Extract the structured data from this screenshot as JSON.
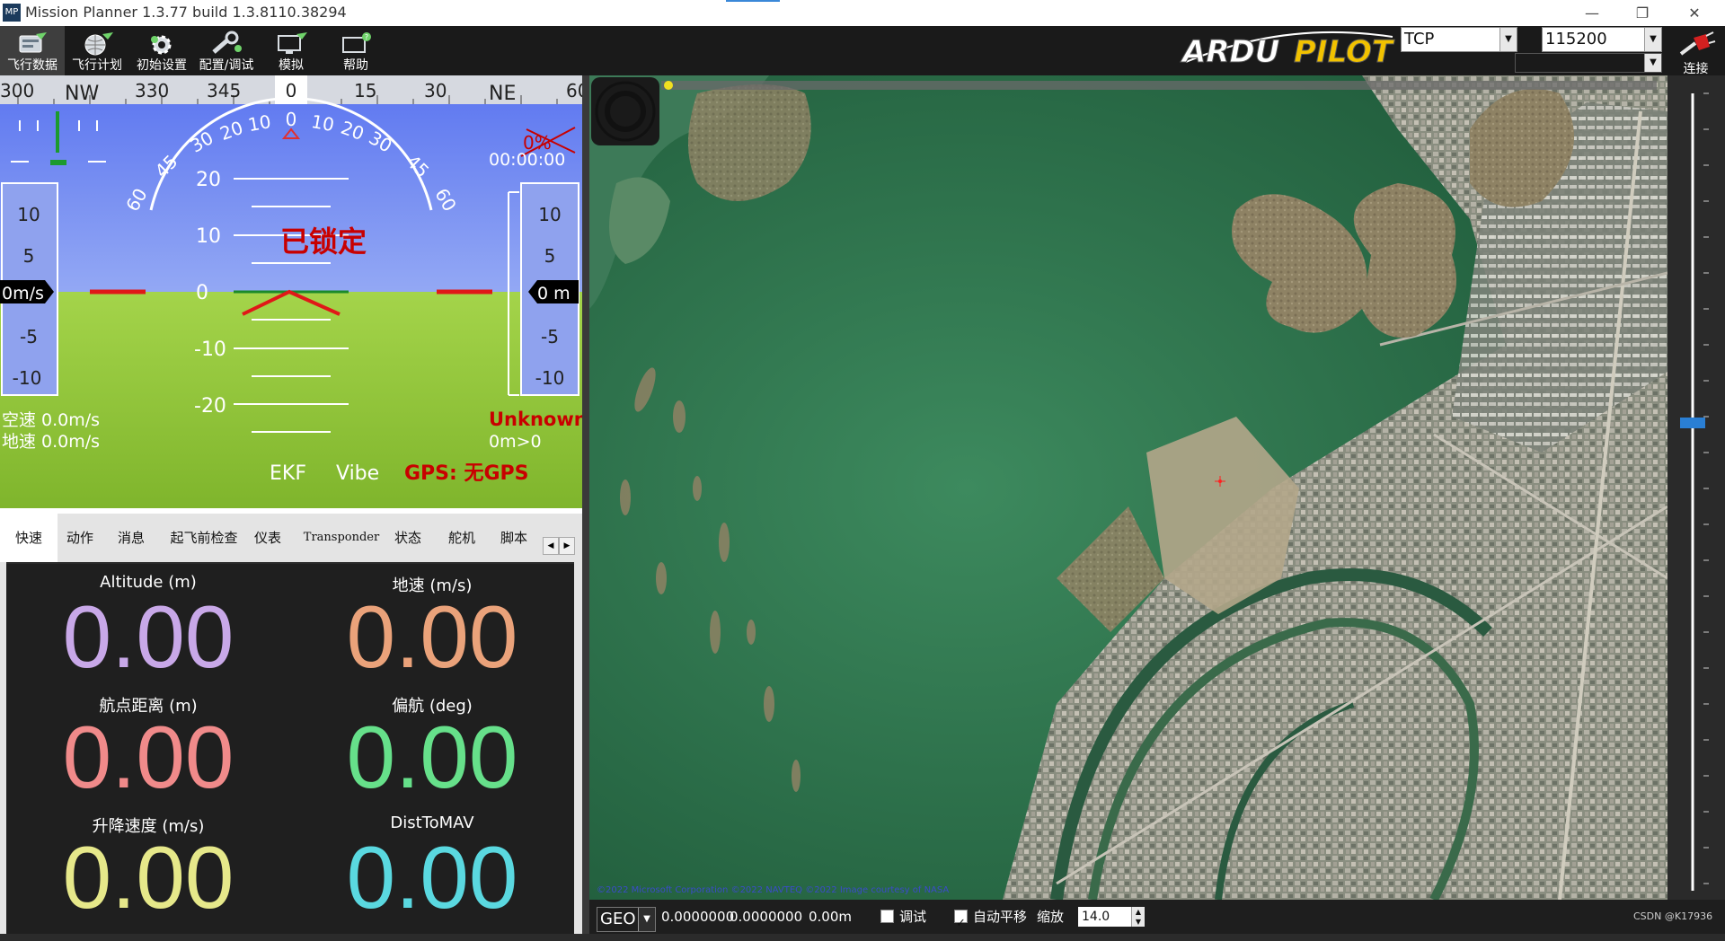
{
  "window": {
    "title": "Mission Planner 1.3.77 build 1.3.8110.38294",
    "app_icon_text": "MP",
    "minimize": "—",
    "restore": "❐",
    "close": "✕"
  },
  "toolbar": {
    "buttons": [
      {
        "label": "飞行数据",
        "icon": "flight-data-icon"
      },
      {
        "label": "飞行计划",
        "icon": "flight-plan-icon"
      },
      {
        "label": "初始设置",
        "icon": "initial-setup-icon"
      },
      {
        "label": "配置/调试",
        "icon": "config-tuning-icon"
      },
      {
        "label": "模拟",
        "icon": "simulation-icon"
      },
      {
        "label": "帮助",
        "icon": "help-icon"
      }
    ],
    "logo_text_a": "ARDU",
    "logo_text_b": "PILOT",
    "connection_type": "TCP",
    "baud_rate": "115200",
    "connect_label": "连接"
  },
  "hud": {
    "heading_ticks": [
      "300",
      "NW",
      "330",
      "345",
      "0",
      "15",
      "30",
      "NE",
      "60"
    ],
    "heading_value": "0",
    "roll_ticks": [
      "60",
      "45",
      "30",
      "20",
      "10",
      "0",
      "10",
      "20",
      "30",
      "45",
      "60"
    ],
    "pitch_ticks": [
      "20",
      "10",
      "0",
      "-10",
      "-20"
    ],
    "speed_ticks": [
      "10",
      "5",
      "-5",
      "-10"
    ],
    "alt_ticks": [
      "10",
      "5",
      "-5",
      "-10"
    ],
    "speed_value": "0m/s",
    "alt_value": "0 m",
    "armed_status": "已锁定",
    "battery_percent": "0%",
    "flight_time": "00:00:00",
    "airspeed": "空速 0.0m/s",
    "groundspeed": "地速 0.0m/s",
    "mode": "Unknown",
    "wp_distance": "0m>0",
    "ekf": "EKF",
    "vibe": "Vibe",
    "gps": "GPS: 无GPS",
    "colors": {
      "sky": "#6f86f2",
      "ground": "#93c93a",
      "warning": "#c80000"
    }
  },
  "tabs": [
    {
      "label": "快速"
    },
    {
      "label": "动作"
    },
    {
      "label": "消息"
    },
    {
      "label": "起飞前检查"
    },
    {
      "label": "仪表"
    },
    {
      "label": "Transponder"
    },
    {
      "label": "状态"
    },
    {
      "label": "舵机"
    },
    {
      "label": "脚本"
    }
  ],
  "quick": [
    {
      "label": "Altitude (m)",
      "value": "0.00",
      "color": "#c8a8e8"
    },
    {
      "label": "地速 (m/s)",
      "value": "0.00",
      "color": "#eaa27a"
    },
    {
      "label": "航点距离 (m)",
      "value": "0.00",
      "color": "#f08a8a"
    },
    {
      "label": "偏航 (deg)",
      "value": "0.00",
      "color": "#66e08a"
    },
    {
      "label": "升降速度 (m/s)",
      "value": "0.00",
      "color": "#e6e88a"
    },
    {
      "label": "DistToMAV",
      "value": "0.00",
      "color": "#5ad8e0"
    }
  ],
  "map": {
    "copyright": "©2022 Microsoft Corporation  ©2022 NAVTEQ  ©2022 Image courtesy of NASA",
    "timeline_marker": "0"
  },
  "status_bar": {
    "coord_system": "GEO",
    "lat": "0.0000000",
    "lon": "0.0000000",
    "alt": "0.00m",
    "debug_label": "调试",
    "autopan_label": "自动平移",
    "zoom_label": "缩放",
    "zoom_value": "14.0",
    "watermark": "CSDN @K17936"
  }
}
